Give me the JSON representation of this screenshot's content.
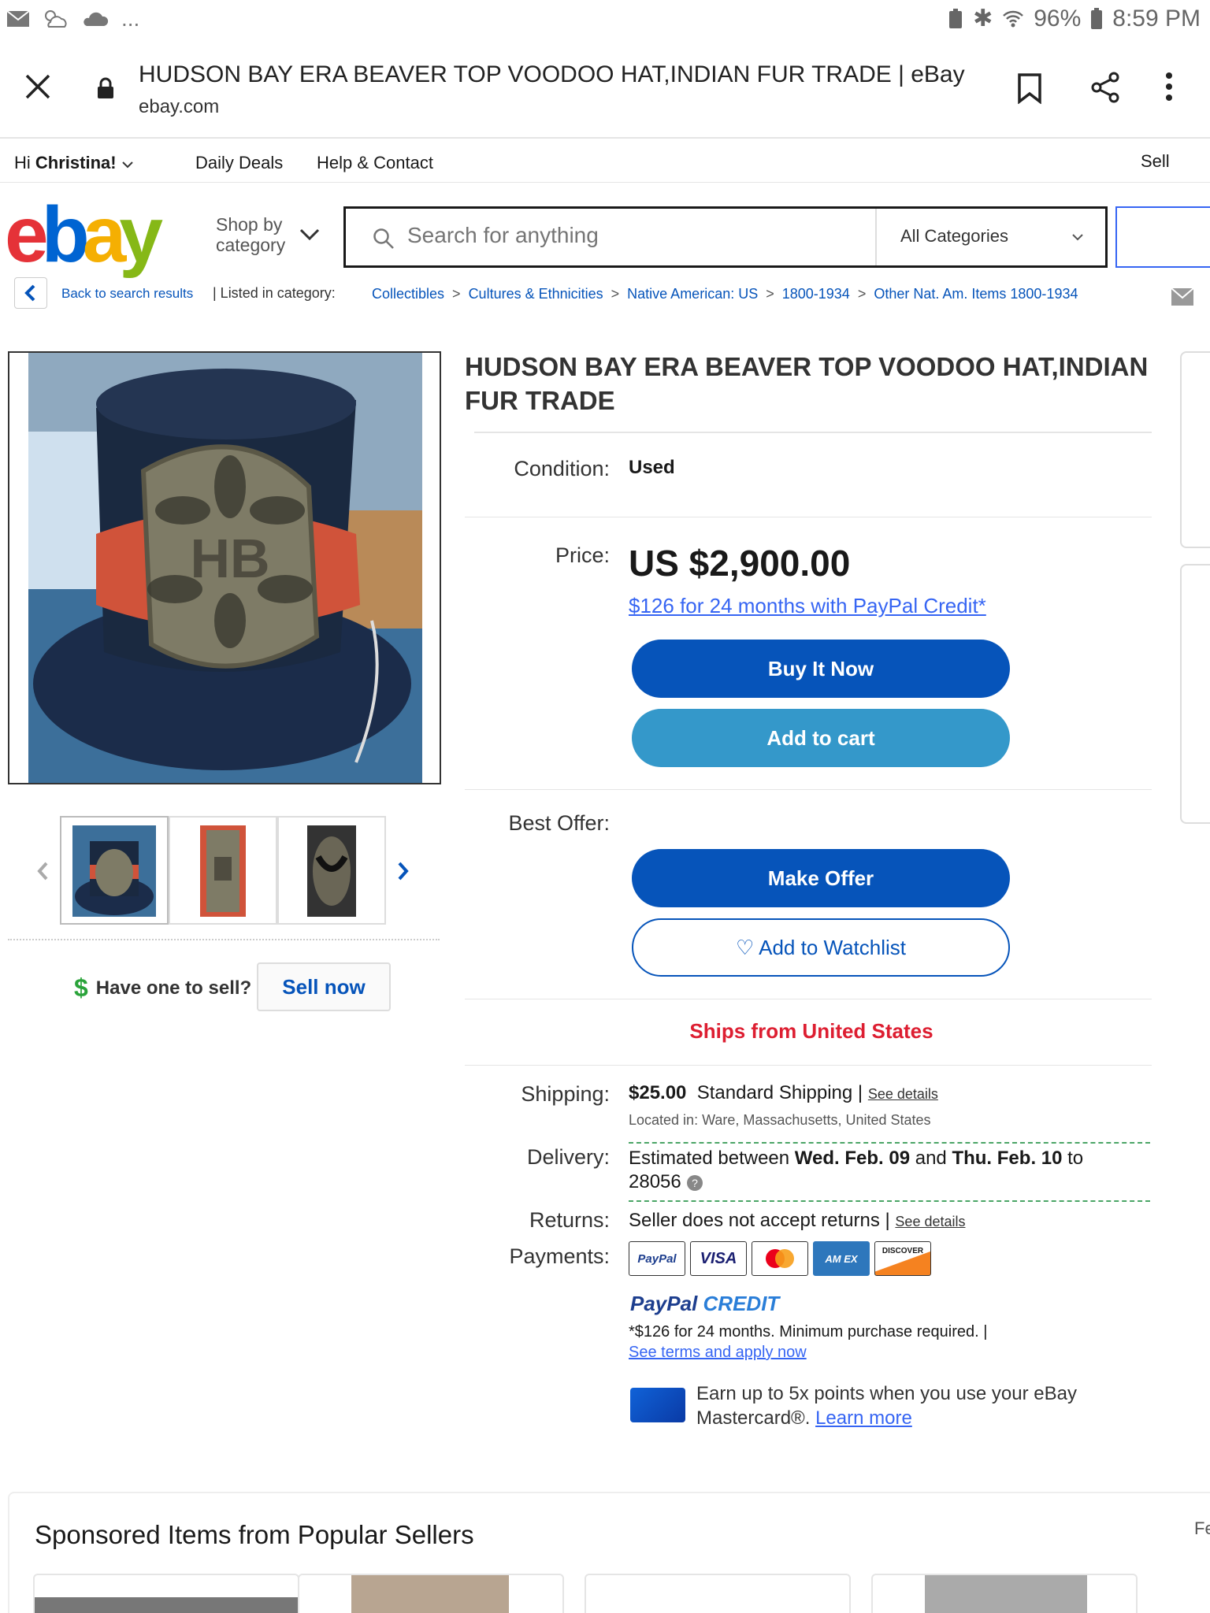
{
  "status": {
    "battery": "96%",
    "time": "8:59 PM",
    "dots": "..."
  },
  "browser": {
    "title": "HUDSON BAY ERA BEAVER TOP VOODOO HAT,INDIAN FUR TRADE | eBay",
    "url": "ebay.com"
  },
  "top_nav": {
    "greeting_prefix": "Hi",
    "greeting_name": "Christina!",
    "daily_deals": "Daily Deals",
    "help": "Help & Contact",
    "sell": "Sell"
  },
  "header": {
    "logo": {
      "e": "e",
      "b": "b",
      "a": "a",
      "y": "y"
    },
    "shop_by_line1": "Shop by",
    "shop_by_line2": "category",
    "search_placeholder": "Search for anything",
    "category": "All Categories"
  },
  "breadcrumb": {
    "back": "Back to search results",
    "listed": "| Listed in category:",
    "items": [
      "Collectibles",
      "Cultures & Ethnicities",
      "Native American: US",
      "1800-1934",
      "Other Nat. Am. Items 1800-1934"
    ],
    "separator": ">"
  },
  "left": {
    "badge_text": "HB",
    "have_one": "Have one to sell?",
    "sell_now": "Sell now"
  },
  "item": {
    "title": "HUDSON BAY ERA BEAVER TOP VOODOO HAT,INDIAN FUR TRADE",
    "condition_label": "Condition:",
    "condition": "Used",
    "price_label": "Price:",
    "price": "US $2,900.00",
    "paypal_credit": "$126 for 24 months with PayPal Credit*",
    "buy_now": "Buy It Now",
    "add_cart": "Add to cart",
    "best_offer_label": "Best Offer:",
    "make_offer": "Make Offer",
    "watchlist": "Add to Watchlist",
    "ships_from": "Ships from United States",
    "shipping_label": "Shipping:",
    "shipping_cost": "$25.00",
    "shipping_method": "Standard Shipping |",
    "see_details": "See details",
    "located": "Located in: Ware, Massachusetts, United States",
    "delivery_label": "Delivery:",
    "delivery_pre": "Estimated between",
    "delivery_d1": "Wed. Feb. 09",
    "delivery_and": "and",
    "delivery_d2": "Thu. Feb. 10",
    "delivery_to": "to",
    "delivery_zip": "28056",
    "returns_label": "Returns:",
    "returns": "Seller does not accept returns |",
    "payments_label": "Payments:",
    "pay_methods": [
      "PayPal",
      "VISA",
      "",
      "AM EX",
      "DISCOVER"
    ],
    "pp_credit_a": "PayPal",
    "pp_credit_b": "CREDIT",
    "terms_line": "*$126 for 24 months. Minimum purchase required. |",
    "terms_link": "See terms and apply now",
    "earn": "Earn up to 5x points when you use your eBay Mastercard®.",
    "learn_more": "Learn more"
  },
  "sponsored": {
    "title": "Sponsored Items from Popular Sellers",
    "feedback": "Fe"
  },
  "colors": {
    "ebay_red": "#e53238",
    "ebay_blue": "#0064d2",
    "ebay_yellow": "#f5af02",
    "ebay_green": "#86b817",
    "primary": "#0654ba",
    "secondary": "#3498ca",
    "alert": "#dd1e31"
  }
}
